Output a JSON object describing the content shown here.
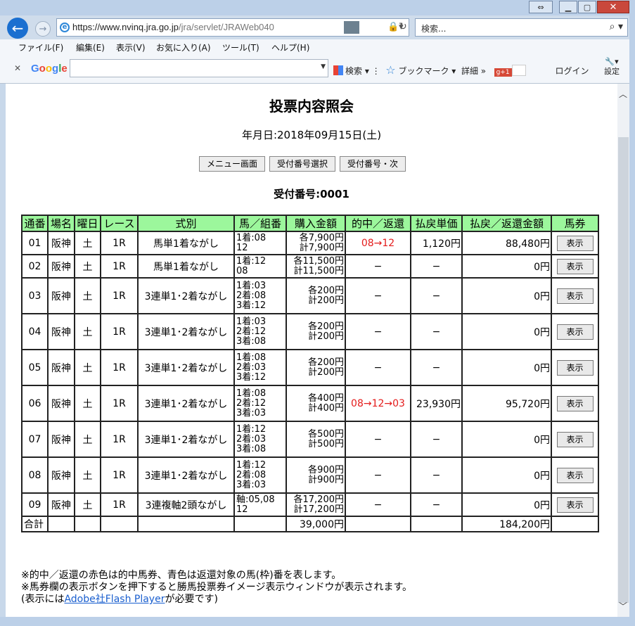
{
  "browser": {
    "url_host": "https://www.nvinq.jra.go.jp",
    "url_path": "/jra/servlet/JRAWeb040",
    "search_placeholder": "検索...",
    "menu": [
      "ファイル(F)",
      "編集(E)",
      "表示(V)",
      "お気に入り(A)",
      "ツール(T)",
      "ヘルプ(H)"
    ],
    "google_logo": "Google",
    "google_search_label": "検索",
    "bookmark_label": "ブックマーク",
    "detail_label": "詳細",
    "login_label": "ログイン",
    "settings_label": "設定",
    "gplus_label": "g+1"
  },
  "page": {
    "title": "投票内容照会",
    "date_line": "年月日:2018年09月15日(土)",
    "buttons": [
      "メニュー画面",
      "受付番号選択",
      "受付番号・次"
    ],
    "receipt_line": "受付番号:0001",
    "headers": [
      "通番",
      "場名",
      "曜日",
      "レース",
      "式別",
      "馬／組番",
      "購入金額",
      "的中／返還",
      "払戻単価",
      "払戻／返還金額",
      "馬券"
    ],
    "rows": [
      {
        "no": "01",
        "place": "阪神",
        "day": "土",
        "race": "1R",
        "type": "馬単1着ながし",
        "combo": [
          "1着:08",
          "12"
        ],
        "amount": [
          "各7,900円",
          "計7,900円"
        ],
        "hit": "08→12",
        "hit_red": true,
        "unit": "1,120円",
        "payout": "88,480円",
        "ticket": "表示"
      },
      {
        "no": "02",
        "place": "阪神",
        "day": "土",
        "race": "1R",
        "type": "馬単1着ながし",
        "combo": [
          "1着:12",
          "08"
        ],
        "amount": [
          "各11,500円",
          "計11,500円"
        ],
        "hit": "−",
        "hit_red": false,
        "unit": "−",
        "payout": "0円",
        "ticket": "表示"
      },
      {
        "no": "03",
        "place": "阪神",
        "day": "土",
        "race": "1R",
        "type": "3連単1･2着ながし",
        "combo": [
          "1着:03",
          "2着:08",
          "3着:12"
        ],
        "amount": [
          "各200円",
          "計200円"
        ],
        "hit": "−",
        "hit_red": false,
        "unit": "−",
        "payout": "0円",
        "ticket": "表示"
      },
      {
        "no": "04",
        "place": "阪神",
        "day": "土",
        "race": "1R",
        "type": "3連単1･2着ながし",
        "combo": [
          "1着:03",
          "2着:12",
          "3着:08"
        ],
        "amount": [
          "各200円",
          "計200円"
        ],
        "hit": "−",
        "hit_red": false,
        "unit": "−",
        "payout": "0円",
        "ticket": "表示"
      },
      {
        "no": "05",
        "place": "阪神",
        "day": "土",
        "race": "1R",
        "type": "3連単1･2着ながし",
        "combo": [
          "1着:08",
          "2着:03",
          "3着:12"
        ],
        "amount": [
          "各200円",
          "計200円"
        ],
        "hit": "−",
        "hit_red": false,
        "unit": "−",
        "payout": "0円",
        "ticket": "表示"
      },
      {
        "no": "06",
        "place": "阪神",
        "day": "土",
        "race": "1R",
        "type": "3連単1･2着ながし",
        "combo": [
          "1着:08",
          "2着:12",
          "3着:03"
        ],
        "amount": [
          "各400円",
          "計400円"
        ],
        "hit": "08→12→03",
        "hit_red": true,
        "unit": "23,930円",
        "payout": "95,720円",
        "ticket": "表示"
      },
      {
        "no": "07",
        "place": "阪神",
        "day": "土",
        "race": "1R",
        "type": "3連単1･2着ながし",
        "combo": [
          "1着:12",
          "2着:03",
          "3着:08"
        ],
        "amount": [
          "各500円",
          "計500円"
        ],
        "hit": "−",
        "hit_red": false,
        "unit": "−",
        "payout": "0円",
        "ticket": "表示"
      },
      {
        "no": "08",
        "place": "阪神",
        "day": "土",
        "race": "1R",
        "type": "3連単1･2着ながし",
        "combo": [
          "1着:12",
          "2着:08",
          "3着:03"
        ],
        "amount": [
          "各900円",
          "計900円"
        ],
        "hit": "−",
        "hit_red": false,
        "unit": "−",
        "payout": "0円",
        "ticket": "表示"
      },
      {
        "no": "09",
        "place": "阪神",
        "day": "土",
        "race": "1R",
        "type": "3連複軸2頭ながし",
        "combo": [
          "軸:05,08",
          "12"
        ],
        "amount": [
          "各17,200円",
          "計17,200円"
        ],
        "hit": "−",
        "hit_red": false,
        "unit": "−",
        "payout": "0円",
        "ticket": "表示"
      }
    ],
    "total": {
      "label": "合計",
      "amount": "39,000円",
      "payout": "184,200円"
    },
    "notes": {
      "line1": "※的中／返還の赤色は的中馬券、青色は返還対象の馬(枠)番を表します。",
      "line2": "※馬券欄の表示ボタンを押下すると勝馬投票券イメージ表示ウィンドウが表示されます。",
      "line3_pre": "(表示には",
      "line3_link": "Adobe社Flash Player",
      "line3_post": "が必要です)"
    }
  },
  "colors": {
    "header_bg": "#9cf79c",
    "hit_red": "#e41b1b",
    "link": "#1a5fcf"
  }
}
